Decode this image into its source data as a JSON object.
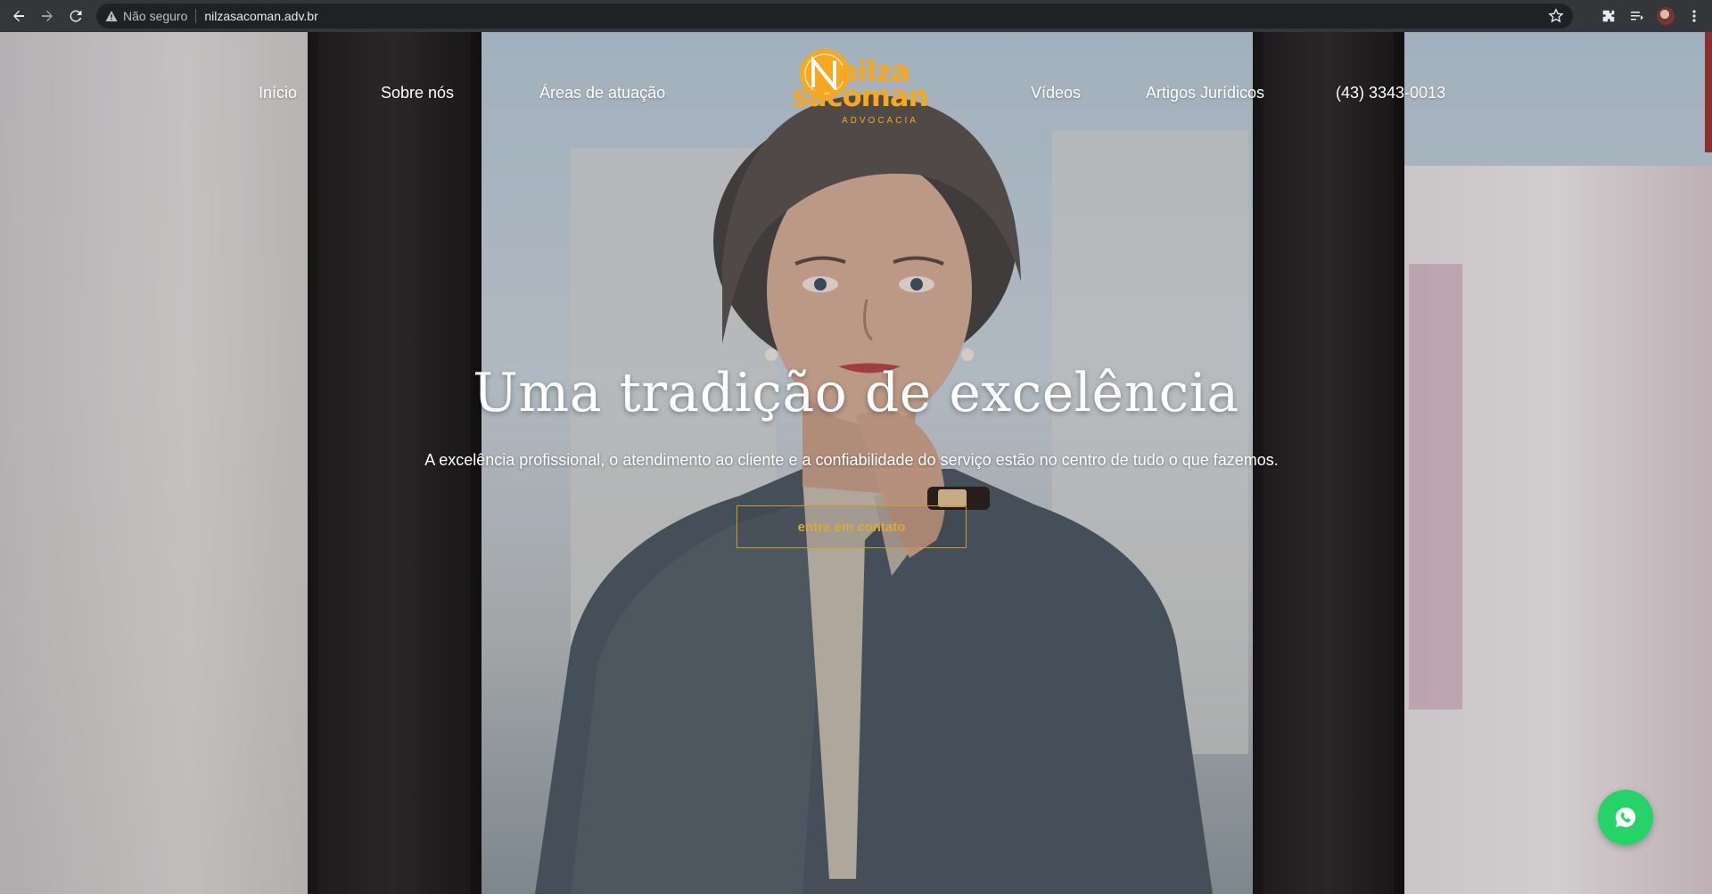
{
  "browser": {
    "security_label": "Não seguro",
    "url": "nilzasacoman.adv.br",
    "icons": [
      "back-icon",
      "forward-icon",
      "reload-icon",
      "warning-icon",
      "star-icon",
      "extensions-icon",
      "reading-list-icon",
      "profile-avatar",
      "menu-icon"
    ]
  },
  "nav": {
    "items": [
      {
        "label": "Início"
      },
      {
        "label": "Sobre nós"
      },
      {
        "label": "Áreas de atuação"
      },
      {
        "label": "Vídeos"
      },
      {
        "label": "Artigos Jurídicos"
      },
      {
        "label": "(43) 3343-0013"
      }
    ]
  },
  "logo": {
    "line1": "nilza",
    "line2": "sacoman",
    "line3": "ADVOCACIA",
    "color": "#f6a821"
  },
  "hero": {
    "headline": "Uma tradição de excelência",
    "subtitle": "A excelência profissional, o atendimento ao cliente e a confiabilidade do serviço estão no centro de tudo o que fazemos.",
    "cta": "entre em contato",
    "accent": "#c99a2e"
  },
  "whatsapp": {
    "icon": "whatsapp-icon",
    "color": "#25d366"
  }
}
